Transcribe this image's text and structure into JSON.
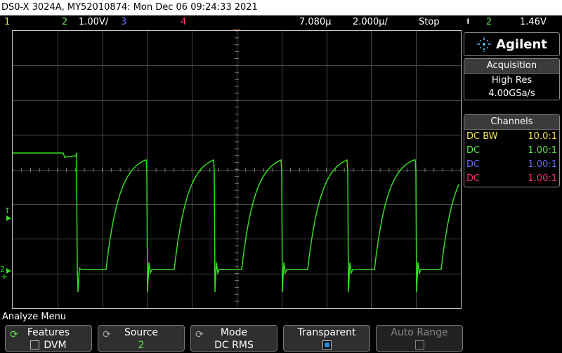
{
  "title": "DS0-X 3024A, MY52010874: Mon Dec 06 09:24:33 2021",
  "status": {
    "ch1": "1",
    "ch2": "2",
    "ch2_scale": "1.00V/",
    "ch3": "3",
    "ch4": "4",
    "delay": "7.080µ",
    "timebase": "2.000µ/",
    "run_state": "Stop",
    "trigger_icon": "trigger-edge-icon",
    "trigger_src": "2",
    "trigger_level": "1.46V"
  },
  "brand": {
    "name": "Agilent",
    "icon": "agilent-spark-icon"
  },
  "acquisition": {
    "title": "Acquisition",
    "mode": "High Res",
    "rate": "4.00GSa/s"
  },
  "channels": {
    "title": "Channels",
    "rows": [
      {
        "coupling": "DC BW",
        "probe": "10.0:1",
        "color": "#f2e64a"
      },
      {
        "coupling": "DC",
        "probe": "1.00:1",
        "color": "#5be34a"
      },
      {
        "coupling": "DC",
        "probe": "1.00:1",
        "color": "#6a6aff"
      },
      {
        "coupling": "DC",
        "probe": "1.00:1",
        "color": "#ff2f7a"
      }
    ]
  },
  "markers": {
    "trigger_t": "T",
    "ch2_ground": "2"
  },
  "menu_title": "Analyze Menu",
  "softkeys": [
    {
      "label": "Features",
      "value": "DVM",
      "icon": "cycle-arrow-icon",
      "checkbox": "off",
      "enabled": true
    },
    {
      "label": "Source",
      "value": "2",
      "icon": "cycle-arrow-icon",
      "enabled": true
    },
    {
      "label": "Mode",
      "value": "DC RMS",
      "icon": "cycle-arrow-icon",
      "enabled": true
    },
    {
      "label": "Transparent",
      "value": "",
      "checkbox": "on",
      "enabled": true
    },
    {
      "label": "Auto Range",
      "value": "",
      "checkbox": "off",
      "enabled": false
    }
  ],
  "colors": {
    "ch1": "#f2e64a",
    "ch2": "#5be34a",
    "ch3": "#6a6aff",
    "ch4": "#ff2f7a",
    "trace": "#33dd22",
    "trigger_marker": "#ff8c1a"
  }
}
